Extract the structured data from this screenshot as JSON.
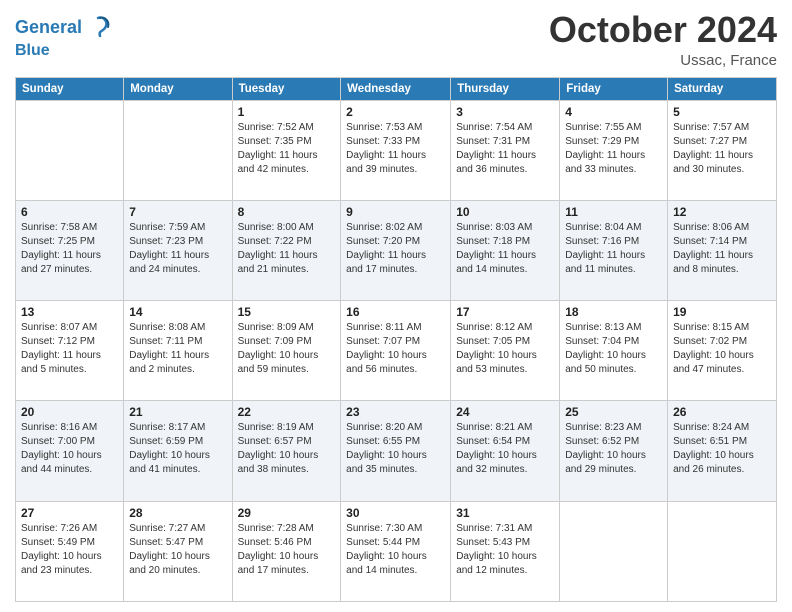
{
  "header": {
    "logo_line1": "General",
    "logo_line2": "Blue",
    "month_title": "October 2024",
    "location": "Ussac, France"
  },
  "weekdays": [
    "Sunday",
    "Monday",
    "Tuesday",
    "Wednesday",
    "Thursday",
    "Friday",
    "Saturday"
  ],
  "weeks": [
    [
      {
        "day": "",
        "info": ""
      },
      {
        "day": "",
        "info": ""
      },
      {
        "day": "1",
        "info": "Sunrise: 7:52 AM\nSunset: 7:35 PM\nDaylight: 11 hours and 42 minutes."
      },
      {
        "day": "2",
        "info": "Sunrise: 7:53 AM\nSunset: 7:33 PM\nDaylight: 11 hours and 39 minutes."
      },
      {
        "day": "3",
        "info": "Sunrise: 7:54 AM\nSunset: 7:31 PM\nDaylight: 11 hours and 36 minutes."
      },
      {
        "day": "4",
        "info": "Sunrise: 7:55 AM\nSunset: 7:29 PM\nDaylight: 11 hours and 33 minutes."
      },
      {
        "day": "5",
        "info": "Sunrise: 7:57 AM\nSunset: 7:27 PM\nDaylight: 11 hours and 30 minutes."
      }
    ],
    [
      {
        "day": "6",
        "info": "Sunrise: 7:58 AM\nSunset: 7:25 PM\nDaylight: 11 hours and 27 minutes."
      },
      {
        "day": "7",
        "info": "Sunrise: 7:59 AM\nSunset: 7:23 PM\nDaylight: 11 hours and 24 minutes."
      },
      {
        "day": "8",
        "info": "Sunrise: 8:00 AM\nSunset: 7:22 PM\nDaylight: 11 hours and 21 minutes."
      },
      {
        "day": "9",
        "info": "Sunrise: 8:02 AM\nSunset: 7:20 PM\nDaylight: 11 hours and 17 minutes."
      },
      {
        "day": "10",
        "info": "Sunrise: 8:03 AM\nSunset: 7:18 PM\nDaylight: 11 hours and 14 minutes."
      },
      {
        "day": "11",
        "info": "Sunrise: 8:04 AM\nSunset: 7:16 PM\nDaylight: 11 hours and 11 minutes."
      },
      {
        "day": "12",
        "info": "Sunrise: 8:06 AM\nSunset: 7:14 PM\nDaylight: 11 hours and 8 minutes."
      }
    ],
    [
      {
        "day": "13",
        "info": "Sunrise: 8:07 AM\nSunset: 7:12 PM\nDaylight: 11 hours and 5 minutes."
      },
      {
        "day": "14",
        "info": "Sunrise: 8:08 AM\nSunset: 7:11 PM\nDaylight: 11 hours and 2 minutes."
      },
      {
        "day": "15",
        "info": "Sunrise: 8:09 AM\nSunset: 7:09 PM\nDaylight: 10 hours and 59 minutes."
      },
      {
        "day": "16",
        "info": "Sunrise: 8:11 AM\nSunset: 7:07 PM\nDaylight: 10 hours and 56 minutes."
      },
      {
        "day": "17",
        "info": "Sunrise: 8:12 AM\nSunset: 7:05 PM\nDaylight: 10 hours and 53 minutes."
      },
      {
        "day": "18",
        "info": "Sunrise: 8:13 AM\nSunset: 7:04 PM\nDaylight: 10 hours and 50 minutes."
      },
      {
        "day": "19",
        "info": "Sunrise: 8:15 AM\nSunset: 7:02 PM\nDaylight: 10 hours and 47 minutes."
      }
    ],
    [
      {
        "day": "20",
        "info": "Sunrise: 8:16 AM\nSunset: 7:00 PM\nDaylight: 10 hours and 44 minutes."
      },
      {
        "day": "21",
        "info": "Sunrise: 8:17 AM\nSunset: 6:59 PM\nDaylight: 10 hours and 41 minutes."
      },
      {
        "day": "22",
        "info": "Sunrise: 8:19 AM\nSunset: 6:57 PM\nDaylight: 10 hours and 38 minutes."
      },
      {
        "day": "23",
        "info": "Sunrise: 8:20 AM\nSunset: 6:55 PM\nDaylight: 10 hours and 35 minutes."
      },
      {
        "day": "24",
        "info": "Sunrise: 8:21 AM\nSunset: 6:54 PM\nDaylight: 10 hours and 32 minutes."
      },
      {
        "day": "25",
        "info": "Sunrise: 8:23 AM\nSunset: 6:52 PM\nDaylight: 10 hours and 29 minutes."
      },
      {
        "day": "26",
        "info": "Sunrise: 8:24 AM\nSunset: 6:51 PM\nDaylight: 10 hours and 26 minutes."
      }
    ],
    [
      {
        "day": "27",
        "info": "Sunrise: 7:26 AM\nSunset: 5:49 PM\nDaylight: 10 hours and 23 minutes."
      },
      {
        "day": "28",
        "info": "Sunrise: 7:27 AM\nSunset: 5:47 PM\nDaylight: 10 hours and 20 minutes."
      },
      {
        "day": "29",
        "info": "Sunrise: 7:28 AM\nSunset: 5:46 PM\nDaylight: 10 hours and 17 minutes."
      },
      {
        "day": "30",
        "info": "Sunrise: 7:30 AM\nSunset: 5:44 PM\nDaylight: 10 hours and 14 minutes."
      },
      {
        "day": "31",
        "info": "Sunrise: 7:31 AM\nSunset: 5:43 PM\nDaylight: 10 hours and 12 minutes."
      },
      {
        "day": "",
        "info": ""
      },
      {
        "day": "",
        "info": ""
      }
    ]
  ]
}
